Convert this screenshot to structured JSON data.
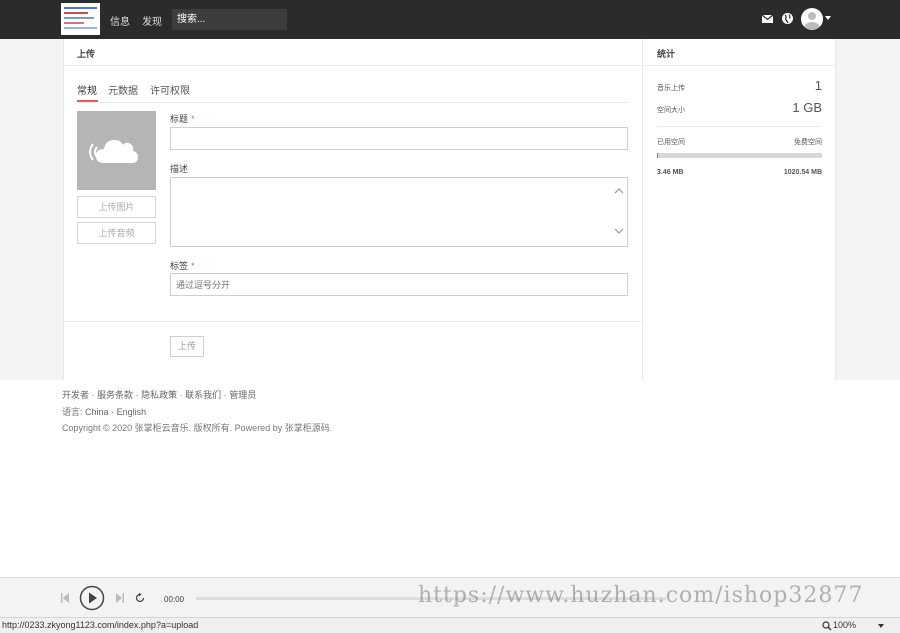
{
  "nav": {
    "link_messages": "信息",
    "link_discover": "发现",
    "search_placeholder": "搜索..."
  },
  "upload_panel": {
    "title": "上传",
    "tabs": [
      "常规",
      "元数据",
      "许可权限"
    ],
    "upload_image_label": "上传图片",
    "upload_audio_label": "上传音频",
    "title_label": "标题",
    "description_label": "描述",
    "tags_label": "标签",
    "required_mark": "*",
    "tags_placeholder": "通过逗号分开",
    "submit_label": "上传"
  },
  "stats_panel": {
    "title": "统计",
    "total_uploads_label": "音乐上传",
    "total_uploads_value": "1",
    "space_size_label": "空间大小",
    "space_size_value": "1 GB",
    "used_space_label": "已用空间",
    "free_space_label": "免费空间",
    "used_space_value": "3.46 MB",
    "free_space_value": "1020.54 MB",
    "used_fraction": 0.0034
  },
  "footer": {
    "links": [
      "开发者",
      "服务条款",
      "隐私政策",
      "联系我们",
      "管理员"
    ],
    "separator": "·",
    "language_label": "语言:",
    "languages": [
      "China",
      "English"
    ],
    "copyright": "Copyright © 2020 张掌柜云音乐. 版权所有. Powered by 张掌柜源码."
  },
  "player": {
    "current_time": "00:00",
    "watermark": "https://www.huzhan.com/ishop32877"
  },
  "statusbar": {
    "url": "http://0233.zkyong1123.com/index.php?a=upload",
    "zoom": "100%"
  },
  "colors": {
    "accent": "#e05b5b",
    "topbar": "#2b2b2b"
  }
}
